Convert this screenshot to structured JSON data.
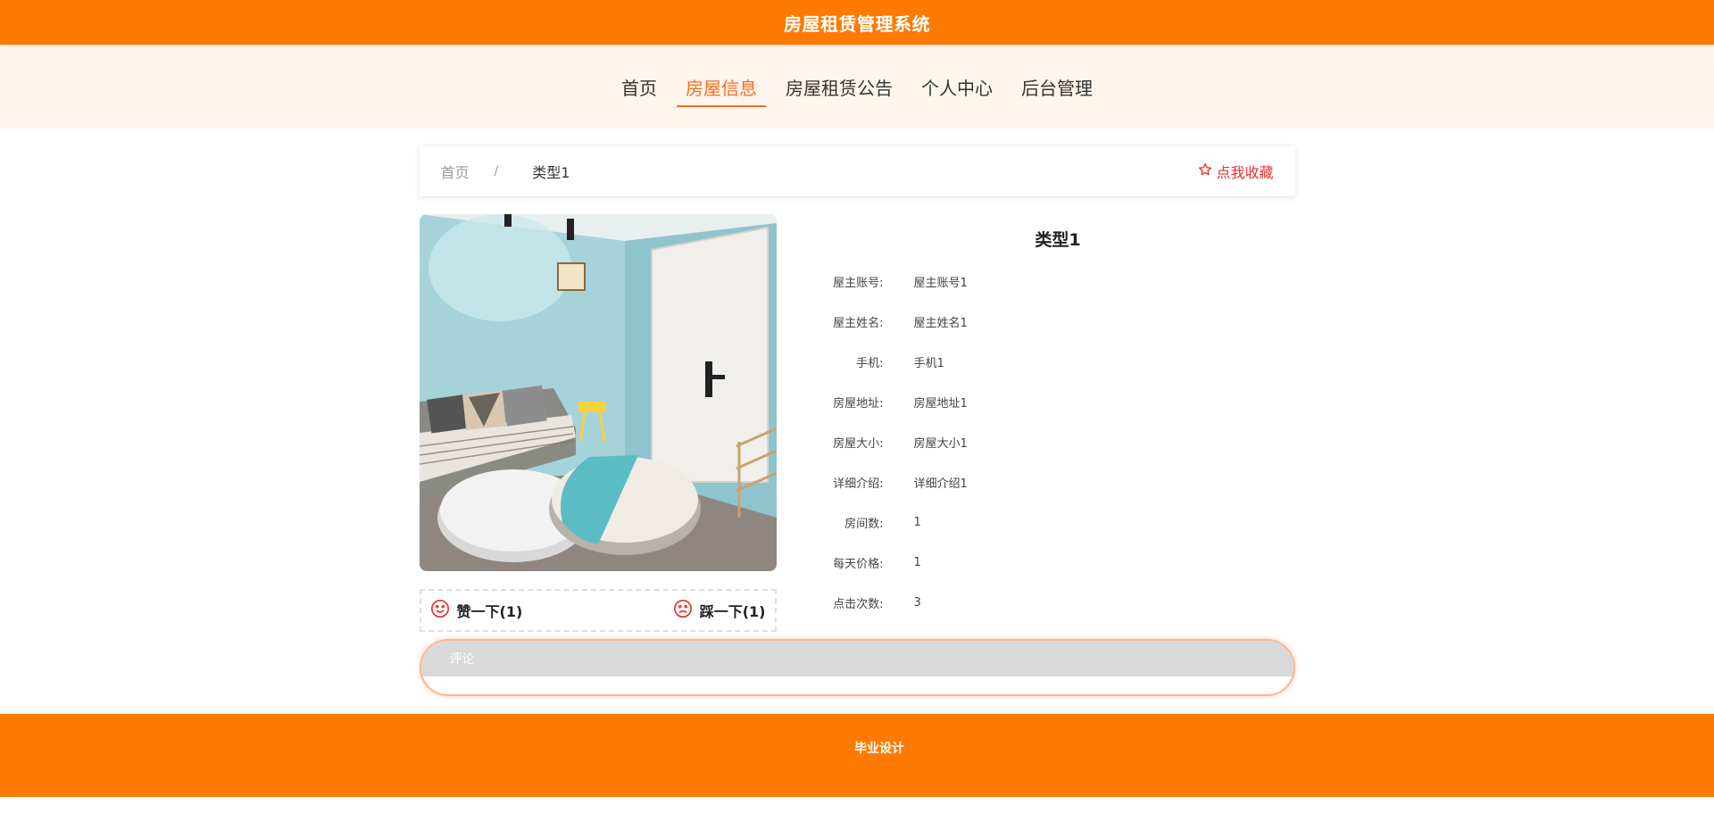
{
  "header": {
    "title": "房屋租赁管理系统"
  },
  "nav": {
    "items": [
      {
        "label": "首页",
        "active": false
      },
      {
        "label": "房屋信息",
        "active": true
      },
      {
        "label": "房屋租赁公告",
        "active": false
      },
      {
        "label": "个人中心",
        "active": false
      },
      {
        "label": "后台管理",
        "active": false
      }
    ]
  },
  "breadcrumb": {
    "home": "首页",
    "separator": "/",
    "current": "类型1"
  },
  "favorite": {
    "label": "点我收藏",
    "icon": "star-outline-icon",
    "color": "#e8302f"
  },
  "house": {
    "title": "类型1",
    "details": [
      {
        "label": "屋主账号:",
        "value": "屋主账号1"
      },
      {
        "label": "屋主姓名:",
        "value": "屋主姓名1"
      },
      {
        "label": "手机:",
        "value": "手机1"
      },
      {
        "label": "房屋地址:",
        "value": "房屋地址1"
      },
      {
        "label": "房屋大小:",
        "value": "房屋大小1"
      },
      {
        "label": "详细介绍:",
        "value": "详细介绍1"
      },
      {
        "label": "房间数:",
        "value": "1"
      },
      {
        "label": "每天价格:",
        "value": "1"
      },
      {
        "label": "点击次数:",
        "value": "3"
      }
    ]
  },
  "votes": {
    "like_label": "赞一下(1)",
    "dislike_label": "踩一下(1)",
    "like_icon": "smile-icon",
    "dislike_icon": "frown-icon",
    "icon_color": "#e8302f"
  },
  "comment": {
    "label": "评论"
  },
  "footer": {
    "text": "毕业设计"
  },
  "colors": {
    "brand": "#ff7a00",
    "nav_bg": "#fff5ec",
    "active": "#ff6a1f"
  }
}
